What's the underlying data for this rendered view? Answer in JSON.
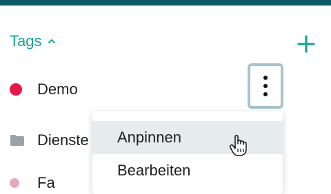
{
  "sidebar": {
    "tags_title": "Tags",
    "tags": [
      {
        "label": "Demo",
        "type": "tag",
        "color": "#e5184c"
      },
      {
        "label": "Dienste",
        "type": "folder",
        "color": "#9aa1a8"
      },
      {
        "label": "Fa",
        "type": "tag",
        "color": "#e3a8c3"
      }
    ]
  },
  "context_menu": {
    "items": [
      {
        "label": "Anpinnen"
      },
      {
        "label": "Bearbeiten"
      }
    ]
  },
  "colors": {
    "top_bar": "#0e5a64",
    "accent": "#17a39a",
    "menu_hover": "#e6ebee"
  },
  "icons": {
    "collapse": "chevron-up-icon",
    "add": "plus-icon",
    "more": "more-vertical-icon",
    "folder": "folder-icon",
    "cursor": "hand-pointer-cursor"
  }
}
